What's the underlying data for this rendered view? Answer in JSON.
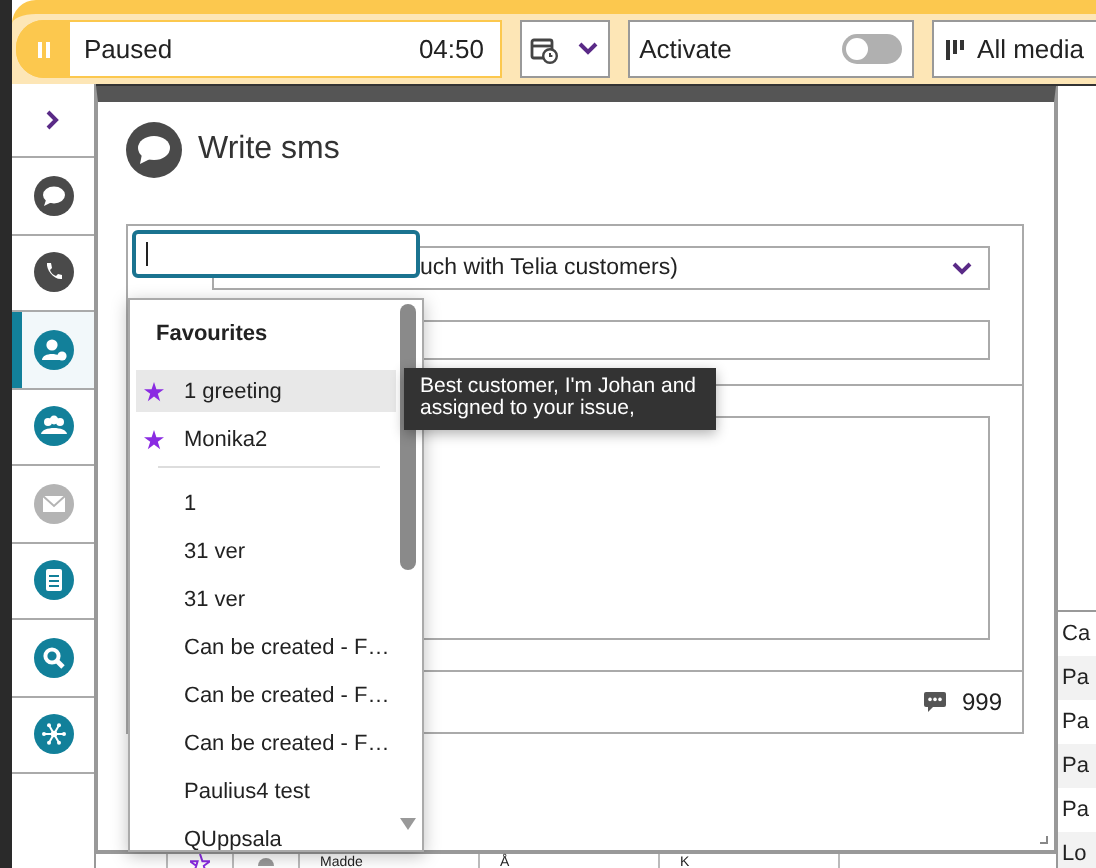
{
  "status": {
    "label": "Paused",
    "time": "04:50",
    "paused": true
  },
  "activate": {
    "label": "Activate",
    "on": false
  },
  "media_filter": {
    "label": "All media"
  },
  "sidebar": {
    "items": [
      {
        "kind": "chat",
        "selected": false,
        "disabled": false
      },
      {
        "kind": "phone",
        "selected": false,
        "disabled": false
      },
      {
        "kind": "contact",
        "selected": true,
        "disabled": false
      },
      {
        "kind": "group",
        "selected": false,
        "disabled": false
      },
      {
        "kind": "mail",
        "selected": false,
        "disabled": true
      },
      {
        "kind": "document",
        "selected": false,
        "disabled": false
      },
      {
        "kind": "search",
        "selected": false,
        "disabled": false
      },
      {
        "kind": "network",
        "selected": false,
        "disabled": false
      }
    ]
  },
  "dialog": {
    "title": "Write sms",
    "template_select": {
      "value": "uch with Telia customers)"
    },
    "counter": "999"
  },
  "template_dropdown": {
    "heading": "Favourites",
    "items": [
      {
        "label": "1 greeting",
        "favourite": true,
        "selected": true
      },
      {
        "label": "Monika2",
        "favourite": true,
        "selected": false
      },
      {
        "label": "1",
        "favourite": false,
        "selected": false
      },
      {
        "label": "31 ver",
        "favourite": false,
        "selected": false
      },
      {
        "label": "31 ver",
        "favourite": false,
        "selected": false
      },
      {
        "label": "Can be created - F…",
        "favourite": false,
        "selected": false
      },
      {
        "label": "Can be created - F…",
        "favourite": false,
        "selected": false
      },
      {
        "label": "Can be created - F…",
        "favourite": false,
        "selected": false
      },
      {
        "label": "Paulius4 test",
        "favourite": false,
        "selected": false
      },
      {
        "label": "QUppsala",
        "favourite": false,
        "selected": false
      }
    ]
  },
  "tooltip": {
    "text": "Best customer, I'm Johan and assigned to your issue,"
  },
  "background_list": [
    "Ca",
    "Pa",
    "Pa",
    "Pa",
    "Pa",
    "Lo"
  ],
  "background_table": {
    "columns": [
      "Madde",
      "Å",
      "K"
    ]
  }
}
